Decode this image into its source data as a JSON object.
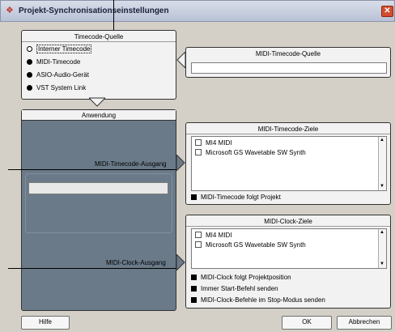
{
  "window": {
    "title": "Projekt-Synchronisationseinstellungen",
    "close_glyph": "✕"
  },
  "timecode_source": {
    "title": "Timecode-Quelle",
    "options": [
      "Interner Timecode",
      "MIDI-Timecode",
      "ASIO-Audio-Gerät",
      "VST System Link"
    ],
    "selected": "Interner Timecode"
  },
  "midi_timecode_source": {
    "title": "MIDI-Timecode-Quelle",
    "value": ""
  },
  "application": {
    "title": "Anwendung",
    "midi_timecode_output_label": "MIDI-Timecode-Ausgang",
    "midi_clock_output_label": "MIDI-Clock-Ausgang"
  },
  "midi_timecode_targets": {
    "title": "MIDI-Timecode-Ziele",
    "items": [
      "MI4 MIDI",
      "Microsoft GS Wavetable SW Synth"
    ],
    "follow_label": "MIDI-Timecode folgt Projekt"
  },
  "midi_clock_targets": {
    "title": "MIDI-Clock-Ziele",
    "items": [
      "MI4 MIDI",
      "Microsoft GS Wavetable SW Synth"
    ],
    "options": [
      "MIDI-Clock folgt Projektposition",
      "Immer Start-Befehl senden",
      "MIDI-Clock-Befehle im Stop-Modus senden"
    ]
  },
  "buttons": {
    "help": "Hilfe",
    "ok": "OK",
    "cancel": "Abbrechen"
  }
}
